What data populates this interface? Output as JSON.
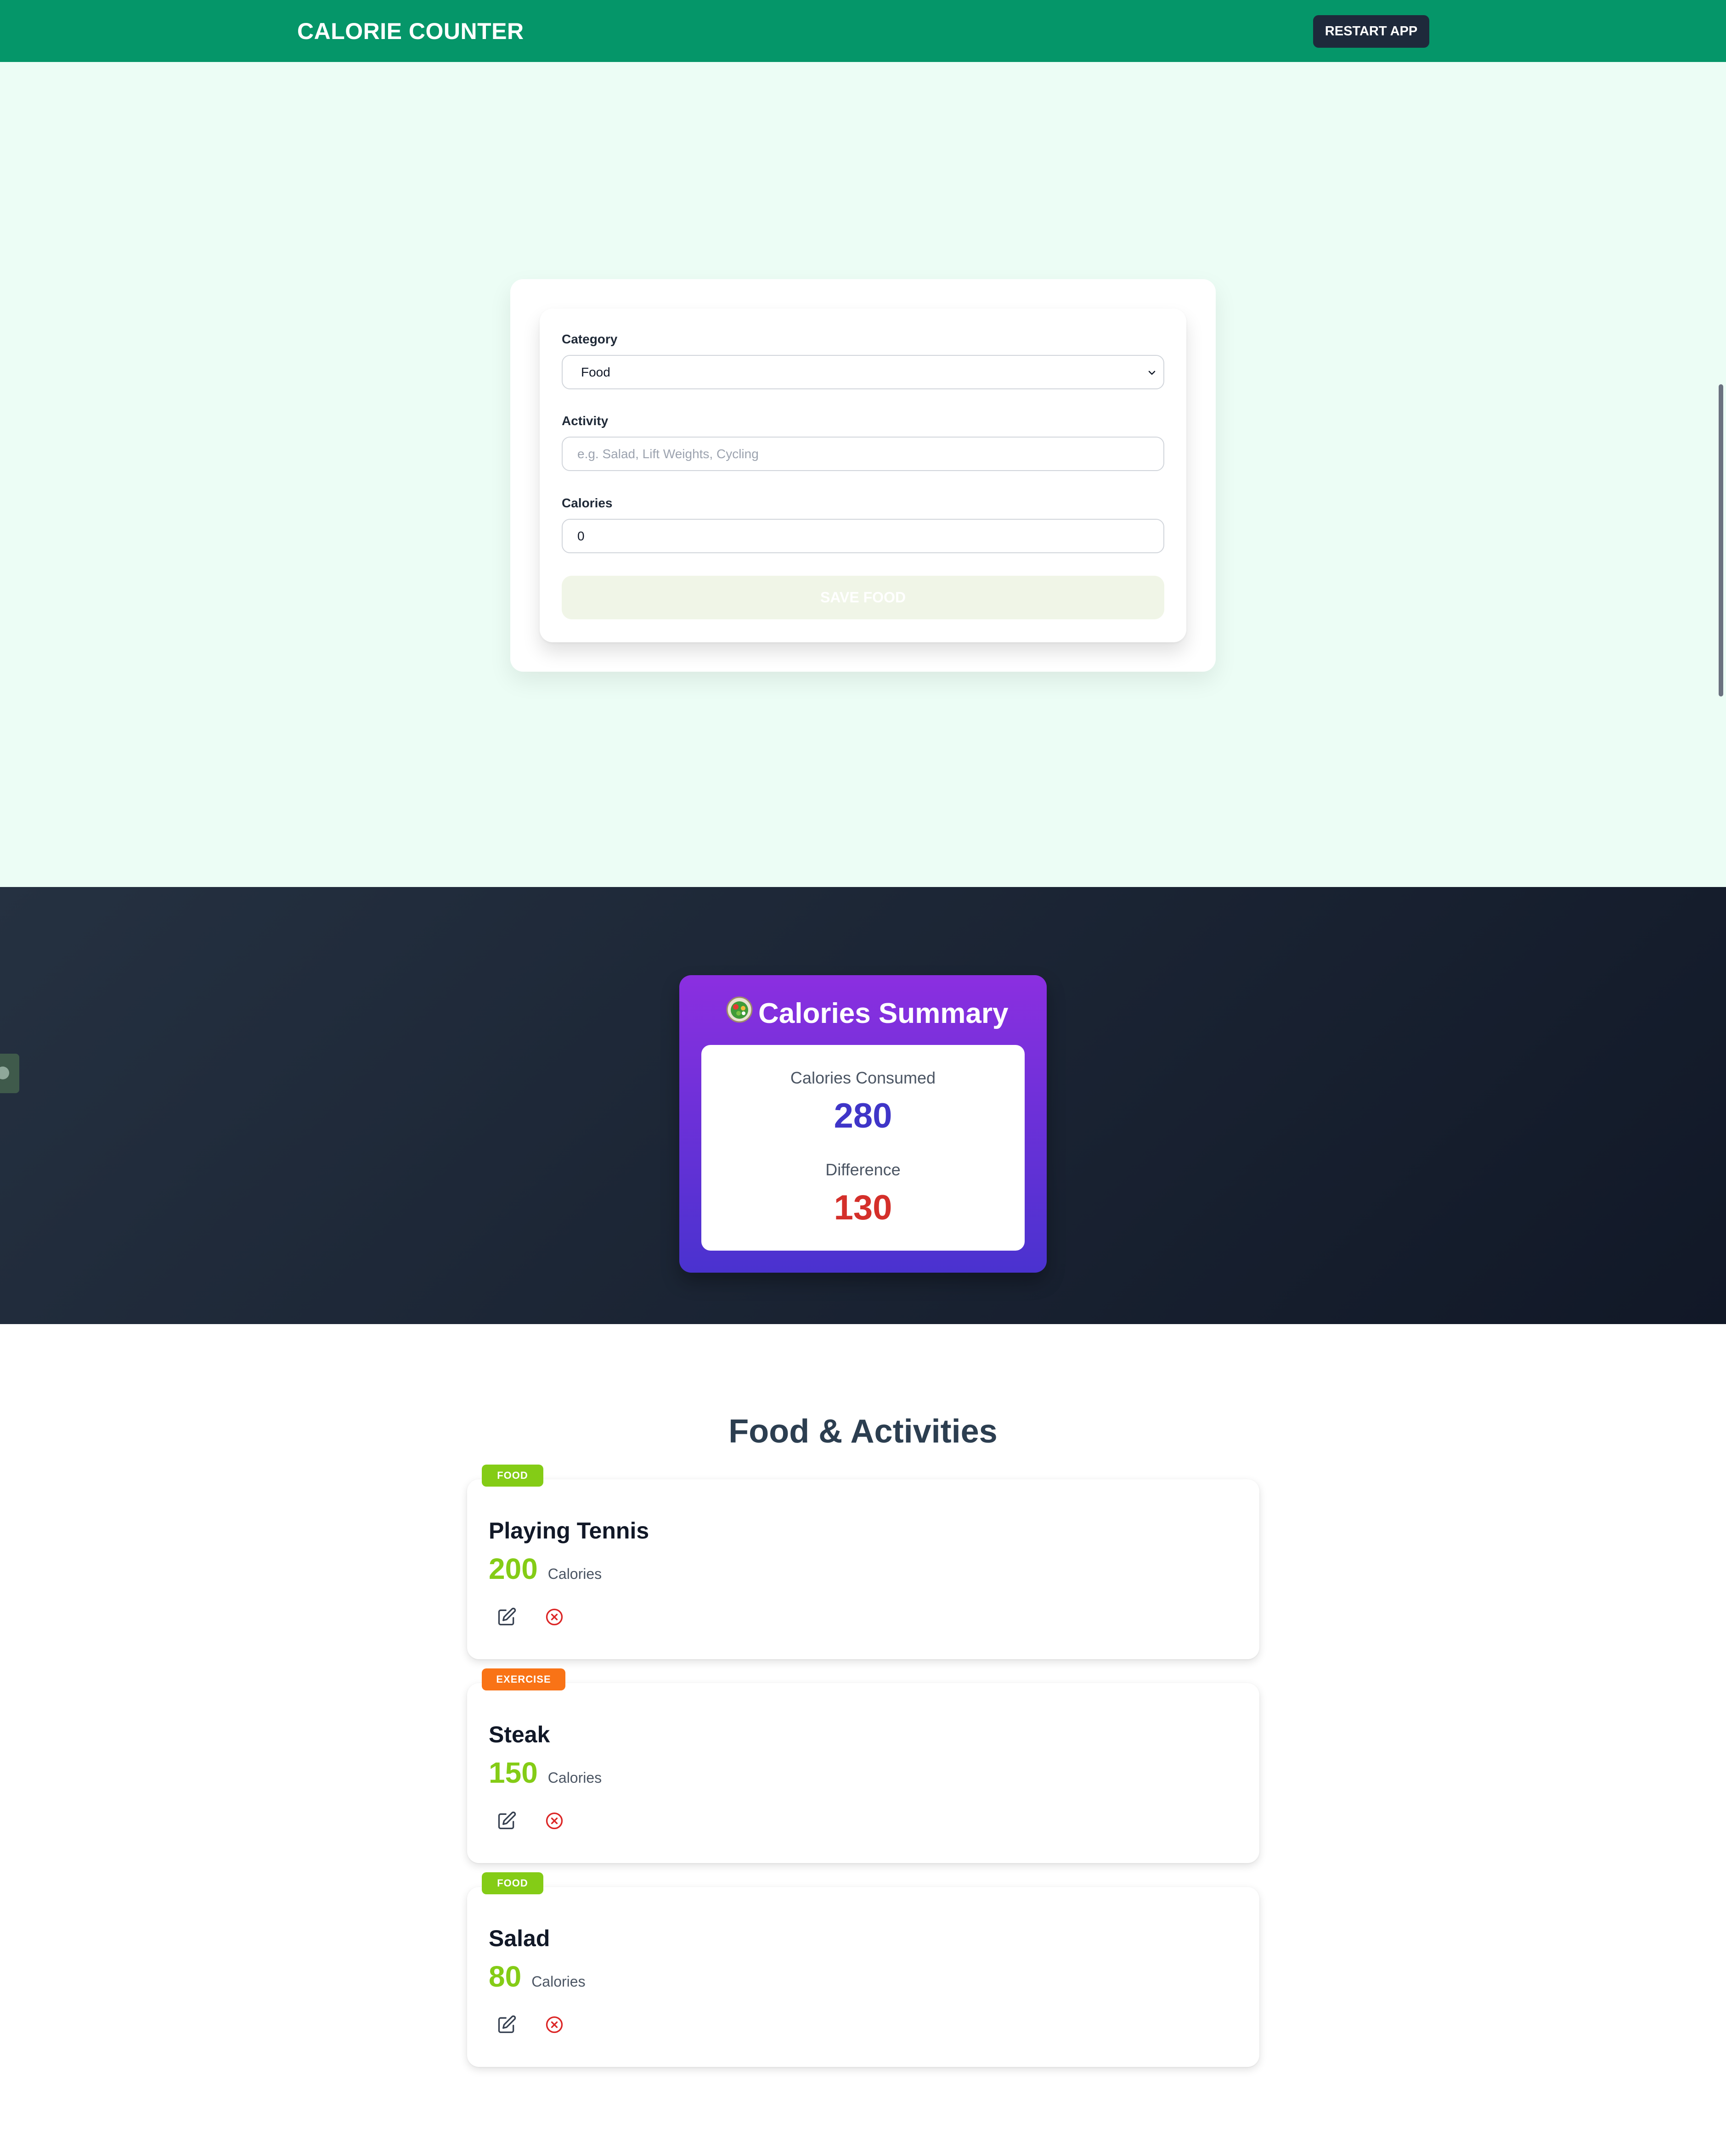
{
  "header": {
    "title": "CALORIE COUNTER",
    "restart_label": "RESTART APP",
    "background_color": "#059669"
  },
  "form": {
    "category_label": "Category",
    "category_selected": "Food",
    "activity_label": "Activity",
    "activity_placeholder": "e.g. Salad, Lift Weights, Cycling",
    "activity_value": "",
    "calories_label": "Calories",
    "calories_value": "0",
    "save_label": "SAVE FOOD"
  },
  "summary": {
    "emoji_icon": "salad-icon",
    "title": "Calories Summary",
    "consumed_label": "Calories Consumed",
    "consumed_value": "280",
    "difference_label": "Difference",
    "difference_value": "130",
    "consumed_color": "#3f35c8",
    "difference_color": "#d42f2a"
  },
  "list": {
    "title": "Food & Activities",
    "calories_unit": "Calories",
    "items": [
      {
        "badge": "FOOD",
        "badge_color": "#84cc16",
        "name": "Playing Tennis",
        "calories": "200"
      },
      {
        "badge": "EXERCISE",
        "badge_color": "#f97316",
        "name": "Steak",
        "calories": "150"
      },
      {
        "badge": "FOOD",
        "badge_color": "#84cc16",
        "name": "Salad",
        "calories": "80"
      }
    ]
  }
}
